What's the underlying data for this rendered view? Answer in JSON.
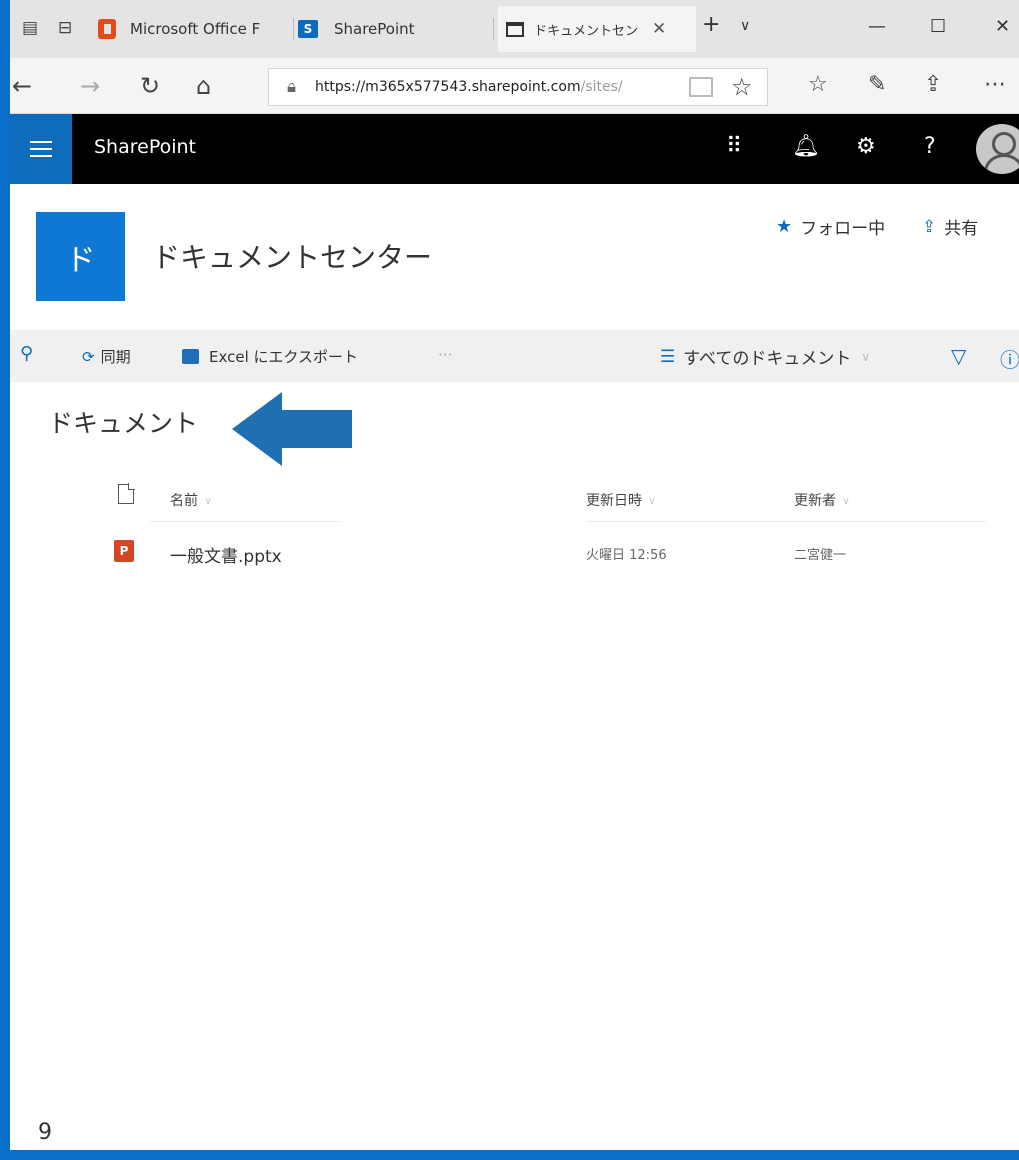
{
  "browser": {
    "tabs": [
      {
        "label": "Microsoft Office F"
      },
      {
        "label": "SharePoint"
      },
      {
        "label": "ドキュメントセン"
      }
    ],
    "new_tab": "+",
    "tab_list": "∨",
    "url_host": "https://m365x577543.sharepoint.com",
    "url_path": "/sites/"
  },
  "suite": {
    "title": "SharePoint"
  },
  "site": {
    "logo_letter": "ド",
    "title": "ドキュメントセンター",
    "follow_label": "フォロー中",
    "share_label": "共有"
  },
  "commands": {
    "sync": "同期",
    "export": "Excel にエクスポート",
    "more": "···",
    "view": "すべてのドキュメント"
  },
  "library": {
    "title": "ドキュメント",
    "columns": {
      "name": "名前",
      "modified": "更新日時",
      "modified_by": "更新者"
    },
    "rows": [
      {
        "name": "一般文書.pptx",
        "modified": "火曜日 12:56",
        "modified_by": "二宮健一"
      }
    ]
  },
  "page_number": "9",
  "colors": {
    "brand_blue": "#0f6cbd",
    "frame_blue": "#0a6fc8",
    "suite_bar": "#000000",
    "arrow_blue": "#1f6fb3"
  }
}
